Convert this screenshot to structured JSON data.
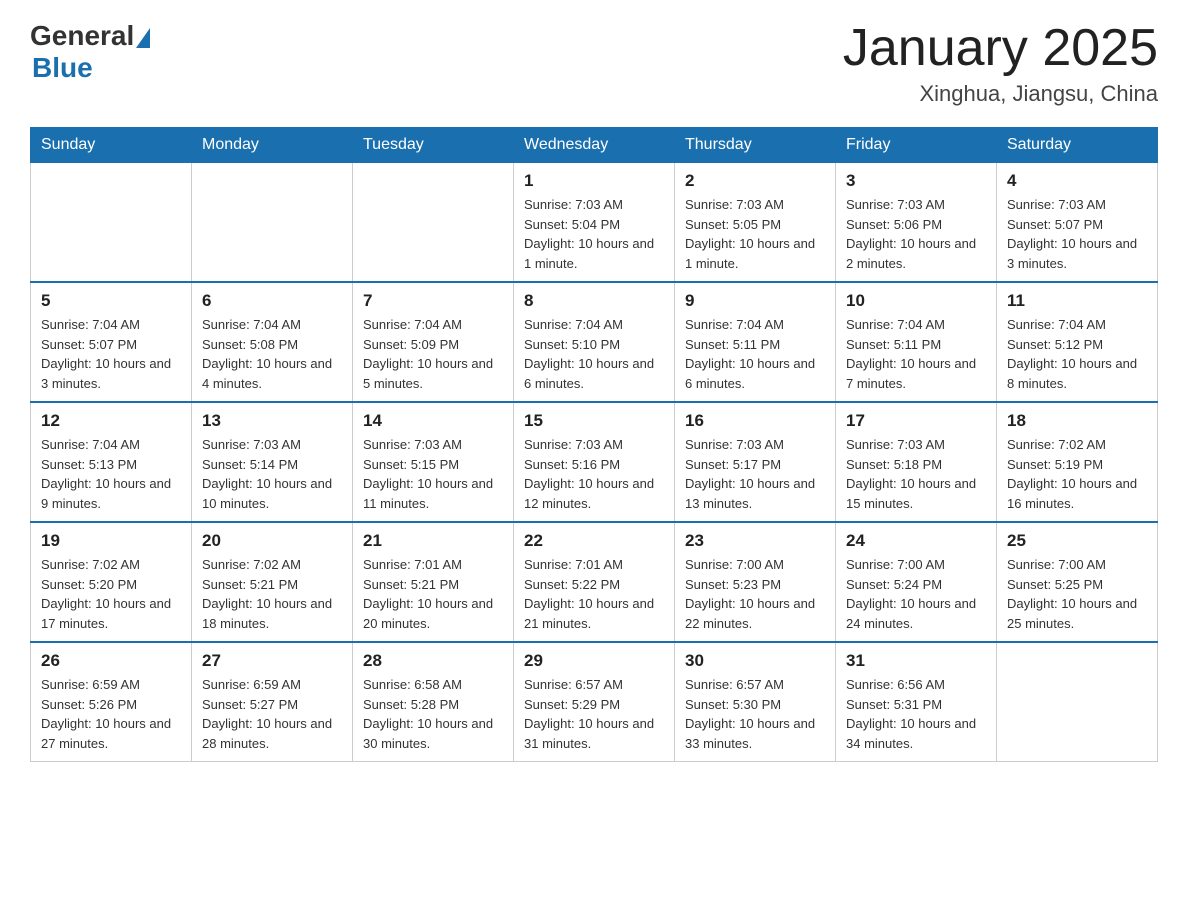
{
  "header": {
    "logo_general": "General",
    "logo_blue": "Blue",
    "title": "January 2025",
    "location": "Xinghua, Jiangsu, China"
  },
  "weekdays": [
    "Sunday",
    "Monday",
    "Tuesday",
    "Wednesday",
    "Thursday",
    "Friday",
    "Saturday"
  ],
  "weeks": [
    [
      {
        "day": "",
        "info": ""
      },
      {
        "day": "",
        "info": ""
      },
      {
        "day": "",
        "info": ""
      },
      {
        "day": "1",
        "info": "Sunrise: 7:03 AM\nSunset: 5:04 PM\nDaylight: 10 hours and 1 minute."
      },
      {
        "day": "2",
        "info": "Sunrise: 7:03 AM\nSunset: 5:05 PM\nDaylight: 10 hours and 1 minute."
      },
      {
        "day": "3",
        "info": "Sunrise: 7:03 AM\nSunset: 5:06 PM\nDaylight: 10 hours and 2 minutes."
      },
      {
        "day": "4",
        "info": "Sunrise: 7:03 AM\nSunset: 5:07 PM\nDaylight: 10 hours and 3 minutes."
      }
    ],
    [
      {
        "day": "5",
        "info": "Sunrise: 7:04 AM\nSunset: 5:07 PM\nDaylight: 10 hours and 3 minutes."
      },
      {
        "day": "6",
        "info": "Sunrise: 7:04 AM\nSunset: 5:08 PM\nDaylight: 10 hours and 4 minutes."
      },
      {
        "day": "7",
        "info": "Sunrise: 7:04 AM\nSunset: 5:09 PM\nDaylight: 10 hours and 5 minutes."
      },
      {
        "day": "8",
        "info": "Sunrise: 7:04 AM\nSunset: 5:10 PM\nDaylight: 10 hours and 6 minutes."
      },
      {
        "day": "9",
        "info": "Sunrise: 7:04 AM\nSunset: 5:11 PM\nDaylight: 10 hours and 6 minutes."
      },
      {
        "day": "10",
        "info": "Sunrise: 7:04 AM\nSunset: 5:11 PM\nDaylight: 10 hours and 7 minutes."
      },
      {
        "day": "11",
        "info": "Sunrise: 7:04 AM\nSunset: 5:12 PM\nDaylight: 10 hours and 8 minutes."
      }
    ],
    [
      {
        "day": "12",
        "info": "Sunrise: 7:04 AM\nSunset: 5:13 PM\nDaylight: 10 hours and 9 minutes."
      },
      {
        "day": "13",
        "info": "Sunrise: 7:03 AM\nSunset: 5:14 PM\nDaylight: 10 hours and 10 minutes."
      },
      {
        "day": "14",
        "info": "Sunrise: 7:03 AM\nSunset: 5:15 PM\nDaylight: 10 hours and 11 minutes."
      },
      {
        "day": "15",
        "info": "Sunrise: 7:03 AM\nSunset: 5:16 PM\nDaylight: 10 hours and 12 minutes."
      },
      {
        "day": "16",
        "info": "Sunrise: 7:03 AM\nSunset: 5:17 PM\nDaylight: 10 hours and 13 minutes."
      },
      {
        "day": "17",
        "info": "Sunrise: 7:03 AM\nSunset: 5:18 PM\nDaylight: 10 hours and 15 minutes."
      },
      {
        "day": "18",
        "info": "Sunrise: 7:02 AM\nSunset: 5:19 PM\nDaylight: 10 hours and 16 minutes."
      }
    ],
    [
      {
        "day": "19",
        "info": "Sunrise: 7:02 AM\nSunset: 5:20 PM\nDaylight: 10 hours and 17 minutes."
      },
      {
        "day": "20",
        "info": "Sunrise: 7:02 AM\nSunset: 5:21 PM\nDaylight: 10 hours and 18 minutes."
      },
      {
        "day": "21",
        "info": "Sunrise: 7:01 AM\nSunset: 5:21 PM\nDaylight: 10 hours and 20 minutes."
      },
      {
        "day": "22",
        "info": "Sunrise: 7:01 AM\nSunset: 5:22 PM\nDaylight: 10 hours and 21 minutes."
      },
      {
        "day": "23",
        "info": "Sunrise: 7:00 AM\nSunset: 5:23 PM\nDaylight: 10 hours and 22 minutes."
      },
      {
        "day": "24",
        "info": "Sunrise: 7:00 AM\nSunset: 5:24 PM\nDaylight: 10 hours and 24 minutes."
      },
      {
        "day": "25",
        "info": "Sunrise: 7:00 AM\nSunset: 5:25 PM\nDaylight: 10 hours and 25 minutes."
      }
    ],
    [
      {
        "day": "26",
        "info": "Sunrise: 6:59 AM\nSunset: 5:26 PM\nDaylight: 10 hours and 27 minutes."
      },
      {
        "day": "27",
        "info": "Sunrise: 6:59 AM\nSunset: 5:27 PM\nDaylight: 10 hours and 28 minutes."
      },
      {
        "day": "28",
        "info": "Sunrise: 6:58 AM\nSunset: 5:28 PM\nDaylight: 10 hours and 30 minutes."
      },
      {
        "day": "29",
        "info": "Sunrise: 6:57 AM\nSunset: 5:29 PM\nDaylight: 10 hours and 31 minutes."
      },
      {
        "day": "30",
        "info": "Sunrise: 6:57 AM\nSunset: 5:30 PM\nDaylight: 10 hours and 33 minutes."
      },
      {
        "day": "31",
        "info": "Sunrise: 6:56 AM\nSunset: 5:31 PM\nDaylight: 10 hours and 34 minutes."
      },
      {
        "day": "",
        "info": ""
      }
    ]
  ]
}
